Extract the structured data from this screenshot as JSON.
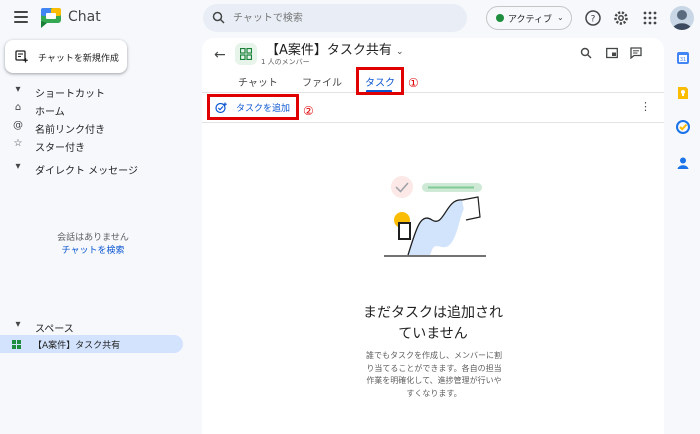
{
  "topbar": {
    "app_name": "Chat",
    "search_placeholder": "チャットで検索",
    "status_label": "アクティブ",
    "status_color": "#1e8e3e"
  },
  "sidebar": {
    "new_chat_label": "チャットを新規作成",
    "shortcuts_heading": "ショートカット",
    "shortcut_items": [
      {
        "icon": "home-icon",
        "label": "ホーム"
      },
      {
        "icon": "at-mention-icon",
        "label": "名前リンク付き"
      },
      {
        "icon": "star-icon",
        "label": "スター付き"
      }
    ],
    "dm_heading": "ダイレクト メッセージ",
    "dm_empty_text": "会話はありません",
    "dm_find_link": "チャットを検索",
    "spaces_heading": "スペース",
    "space_item": "【A案件】タスク共有"
  },
  "main": {
    "space_title": "【A案件】タスク共有",
    "member_count": "1 人のメンバー",
    "tabs": [
      {
        "label": "チャット",
        "active": false
      },
      {
        "label": "ファイル",
        "active": false
      },
      {
        "label": "タスク",
        "active": true
      }
    ],
    "add_task_label": "タスクを追加",
    "empty_title_line1": "まだタスクは追加され",
    "empty_title_line2": "ていません",
    "empty_desc": "誰でもタスクを作成し、メンバーに割り当てることができます。各自の担当作業を明確化して、進捗管理が行いやすくなります。"
  },
  "annotations": {
    "label_1": "①",
    "label_2": "②",
    "color": "#e00000"
  },
  "colors": {
    "accent": "#0b57d0",
    "selected_bg": "#d3e3fd"
  }
}
